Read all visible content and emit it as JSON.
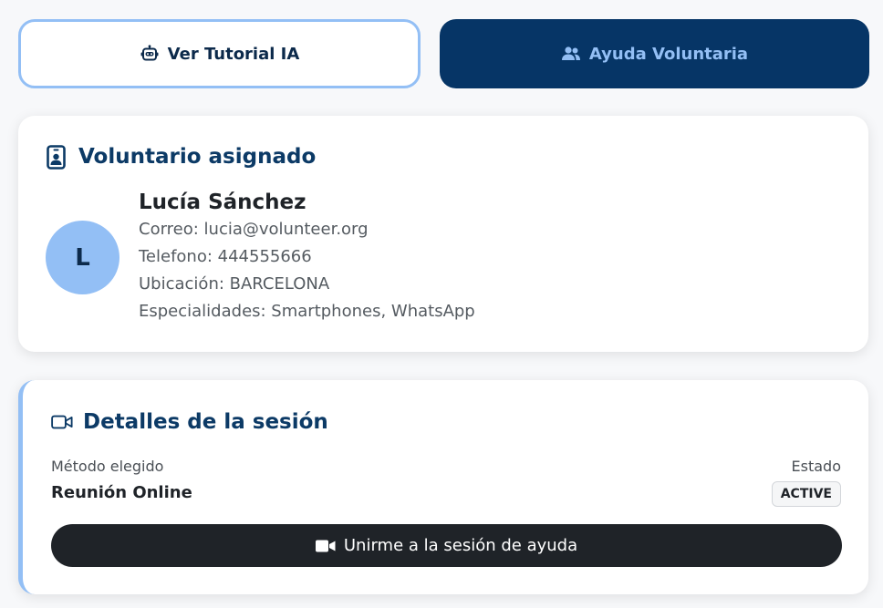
{
  "tabs": {
    "tutorial_label": "Ver Tutorial IA",
    "tutorial_icon": "robot-icon",
    "volunteer_label": "Ayuda Voluntaria",
    "volunteer_icon": "users-icon"
  },
  "volunteer": {
    "title": "Voluntario asignado",
    "title_icon": "id-badge-icon",
    "avatar_initial": "L",
    "name": "Lucía Sánchez",
    "email_line": "Correo: lucia@volunteer.org",
    "phone_line": "Telefono: 444555666",
    "location_line": "Ubicación: BARCELONA",
    "specialties_line": "Especialidades: Smartphones, WhatsApp"
  },
  "session": {
    "title": "Detalles de la sesión",
    "title_icon": "video-camera-icon",
    "method_label": "Método elegido",
    "method_value": "Reunión Online",
    "status_label": "Estado",
    "status_value": "ACTIVE",
    "join_button_label": "Unirme a la sesión de ayuda",
    "join_button_icon": "video-icon"
  },
  "colors": {
    "primary_dark": "#063566",
    "accent_light": "#93bff5",
    "button_dark": "#1f2328",
    "title_blue": "#0c3a66"
  }
}
